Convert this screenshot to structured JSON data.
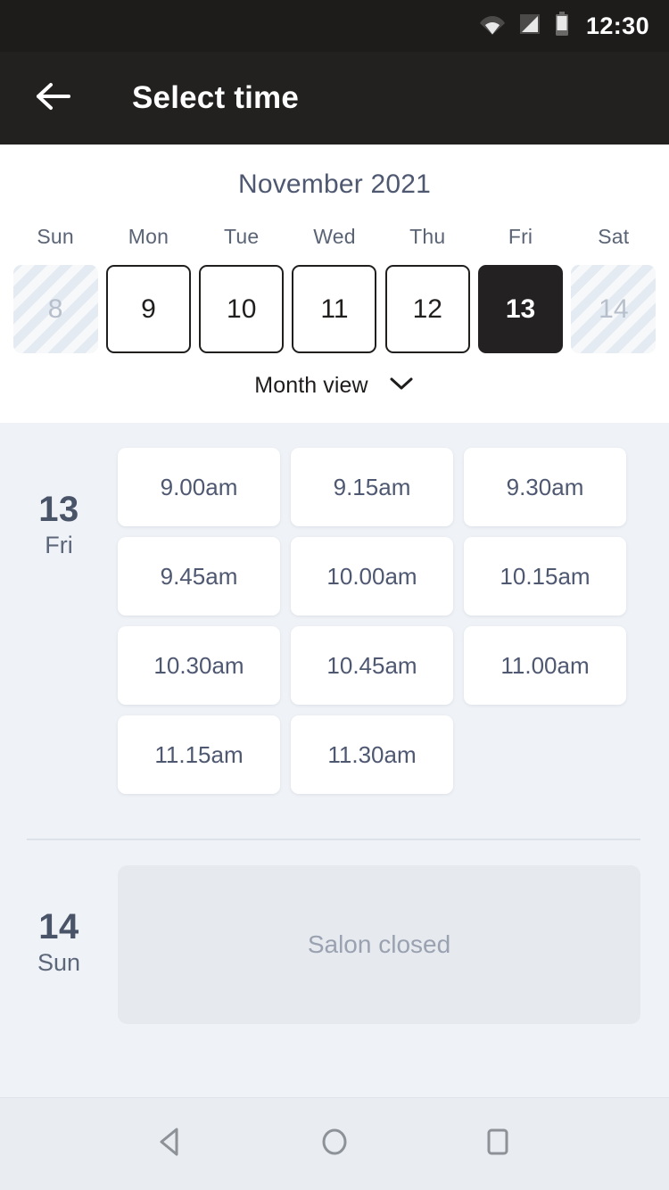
{
  "status_bar": {
    "time": "12:30",
    "icons": [
      "wifi-icon",
      "cellular-signal-icon",
      "battery-icon"
    ]
  },
  "app_bar": {
    "title": "Select time",
    "back_icon": "back-arrow-icon"
  },
  "calendar": {
    "month_title": "November 2021",
    "weekdays": [
      "Sun",
      "Mon",
      "Tue",
      "Wed",
      "Thu",
      "Fri",
      "Sat"
    ],
    "days": [
      {
        "num": "8",
        "state": "disabled"
      },
      {
        "num": "9",
        "state": "available"
      },
      {
        "num": "10",
        "state": "available"
      },
      {
        "num": "11",
        "state": "available"
      },
      {
        "num": "12",
        "state": "available"
      },
      {
        "num": "13",
        "state": "selected"
      },
      {
        "num": "14",
        "state": "disabled"
      }
    ],
    "view_toggle_label": "Month view",
    "view_toggle_icon": "chevron-down-icon"
  },
  "schedule": [
    {
      "day_number": "13",
      "day_name": "Fri",
      "slots": [
        "9.00am",
        "9.15am",
        "9.30am",
        "9.45am",
        "10.00am",
        "10.15am",
        "10.30am",
        "10.45am",
        "11.00am",
        "11.15am",
        "11.30am"
      ],
      "closed_message": null
    },
    {
      "day_number": "14",
      "day_name": "Sun",
      "slots": [],
      "closed_message": "Salon closed"
    }
  ],
  "nav_bar": {
    "back": "nav-back-icon",
    "home": "nav-home-icon",
    "recents": "nav-recents-icon"
  },
  "colors": {
    "status_bar_bg": "#1e1c1b",
    "app_bar_bg": "#232120",
    "page_bg": "#eff2f6",
    "selected_day_bg": "#232122",
    "slot_card_bg": "#ffffff",
    "closed_card_bg": "#e6e9ee",
    "accent_text": "#4e5871"
  }
}
